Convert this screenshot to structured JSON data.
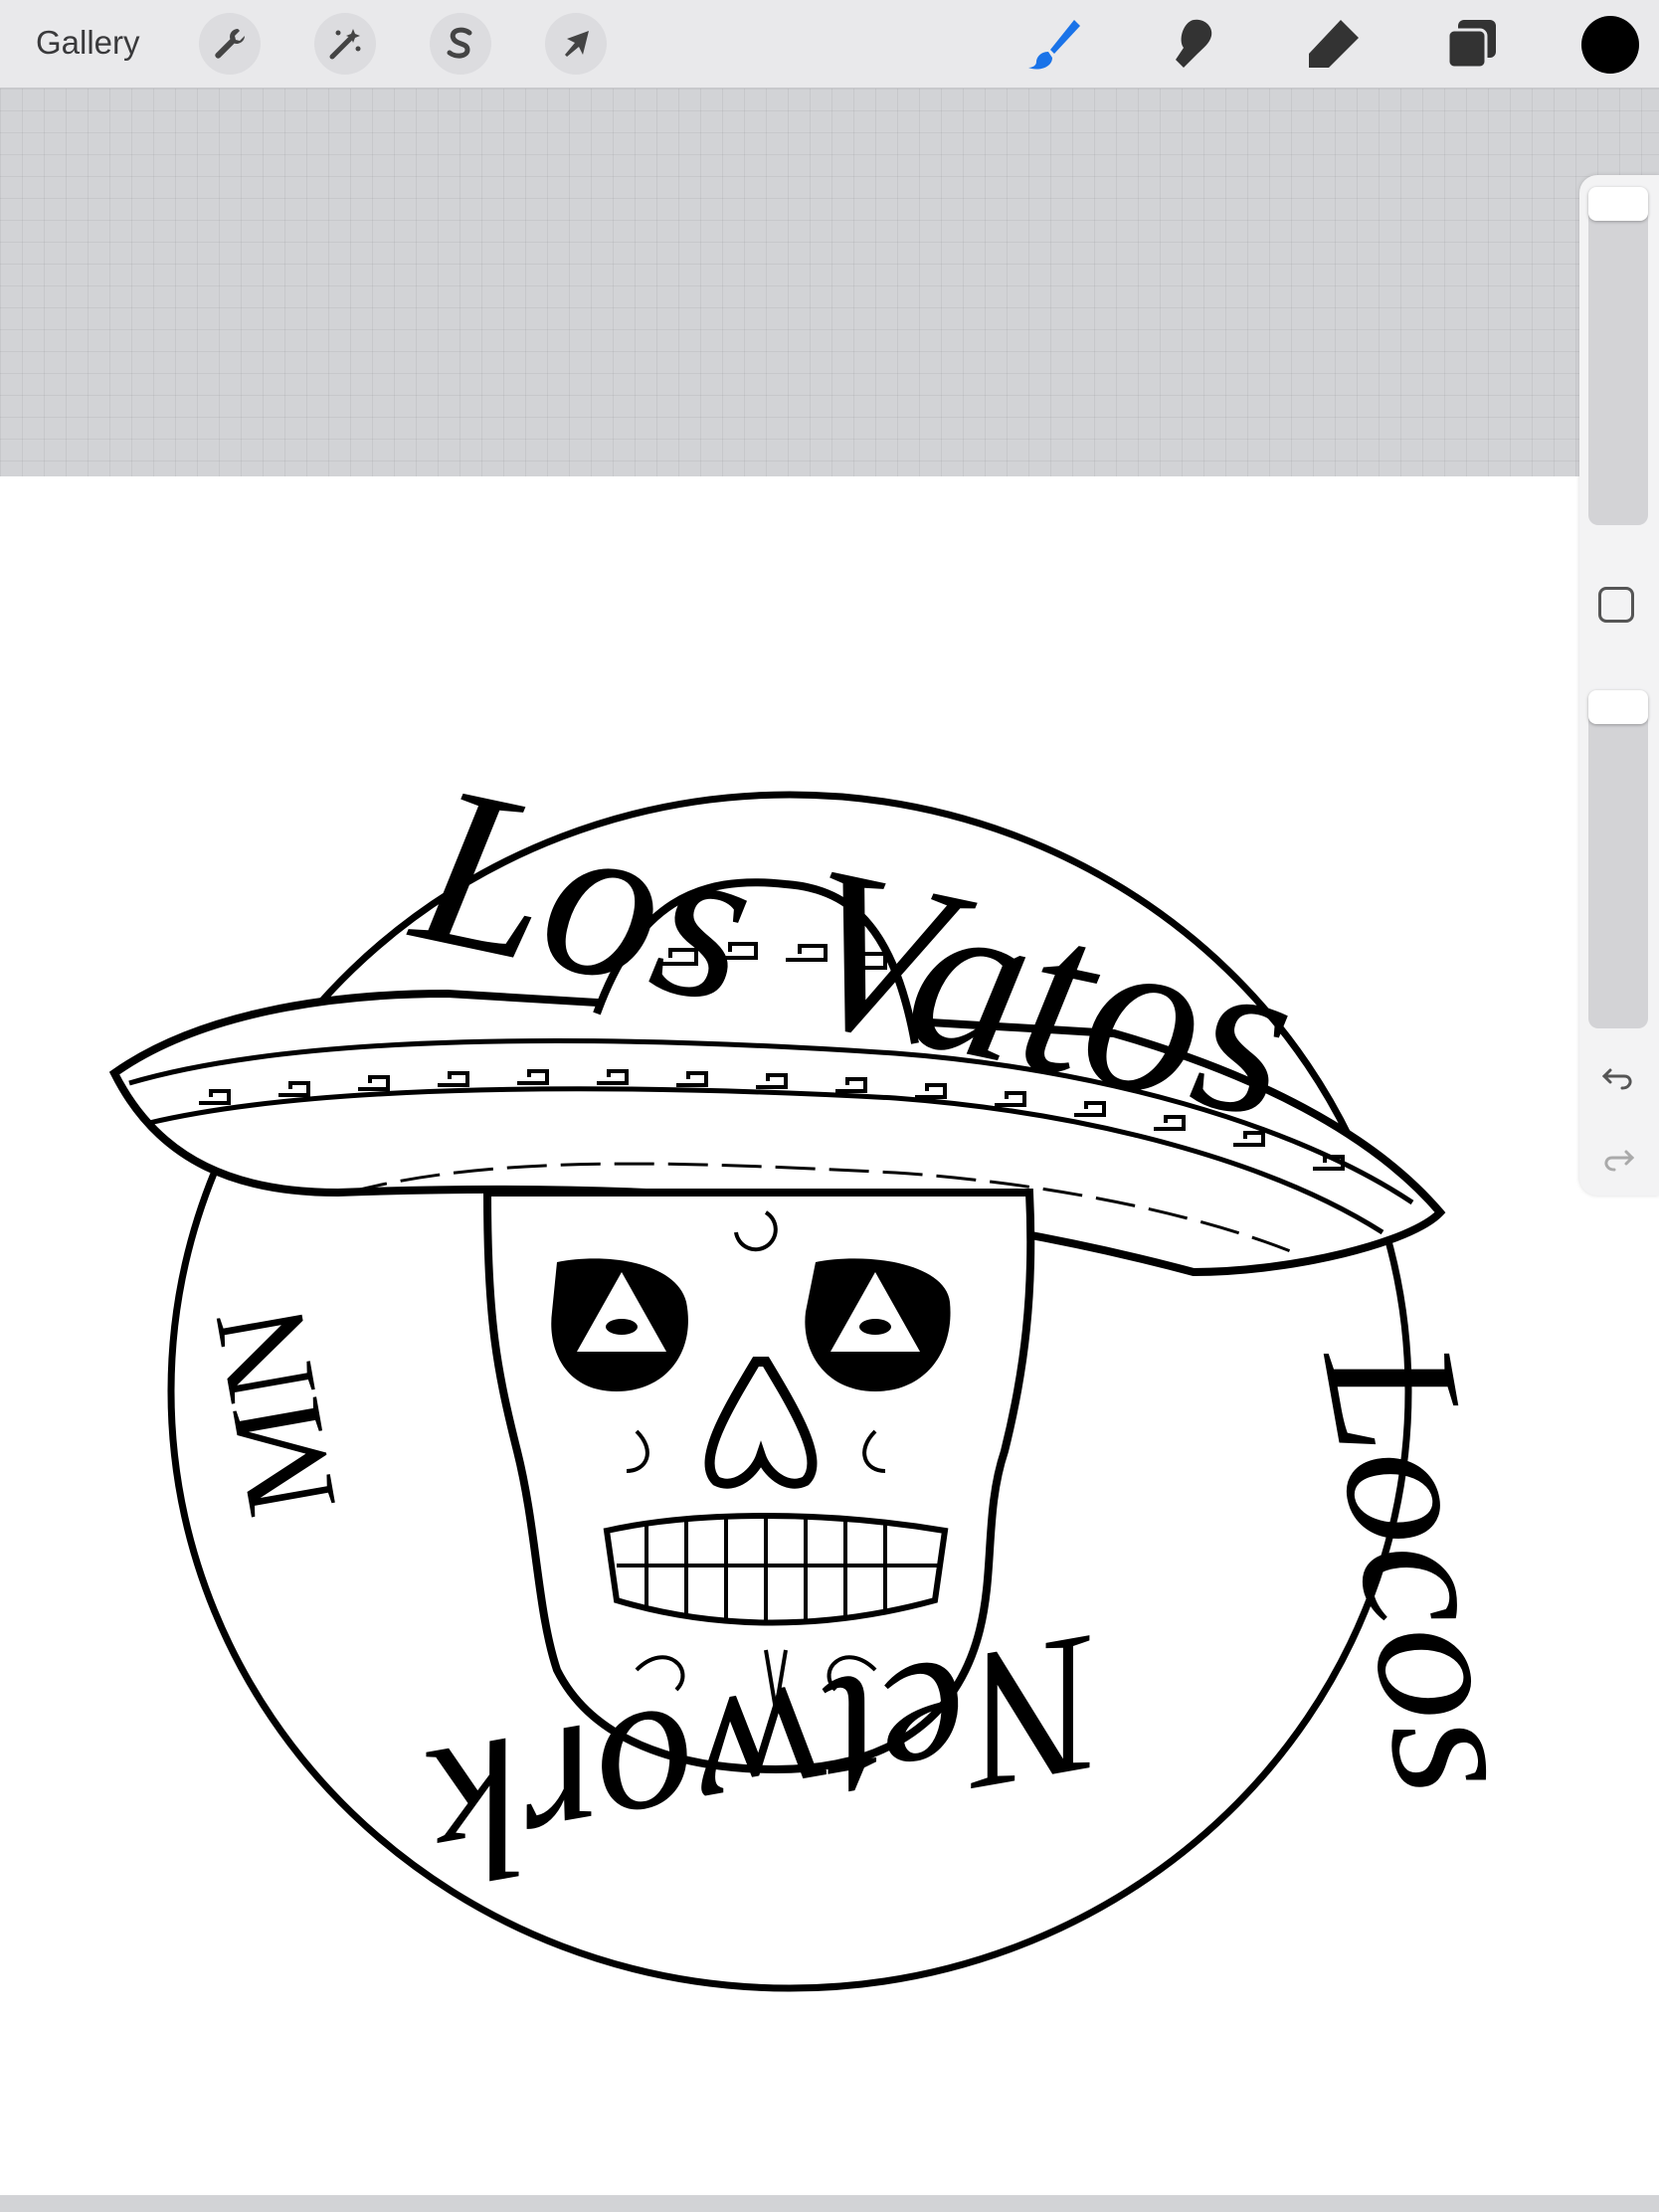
{
  "toolbar": {
    "gallery_label": "Gallery",
    "left_tools": [
      "wrench-icon",
      "magic-wand-icon",
      "selection-s-icon",
      "arrow-transform-icon"
    ],
    "right_tools": [
      "brush-icon",
      "smudge-icon",
      "eraser-icon",
      "layers-icon"
    ],
    "active_tool": "brush",
    "active_color": "#1a73e8",
    "current_color": "#000000"
  },
  "sidebar": {
    "controls": [
      "brush-size-slider",
      "modify-button",
      "opacity-slider",
      "undo-button",
      "redo-button"
    ]
  },
  "artwork": {
    "text_top": "Los Vatos",
    "text_right": "Locos",
    "text_bottom": "Network",
    "text_left": "MN",
    "ring_text": "Los Vatos Locos Network"
  }
}
